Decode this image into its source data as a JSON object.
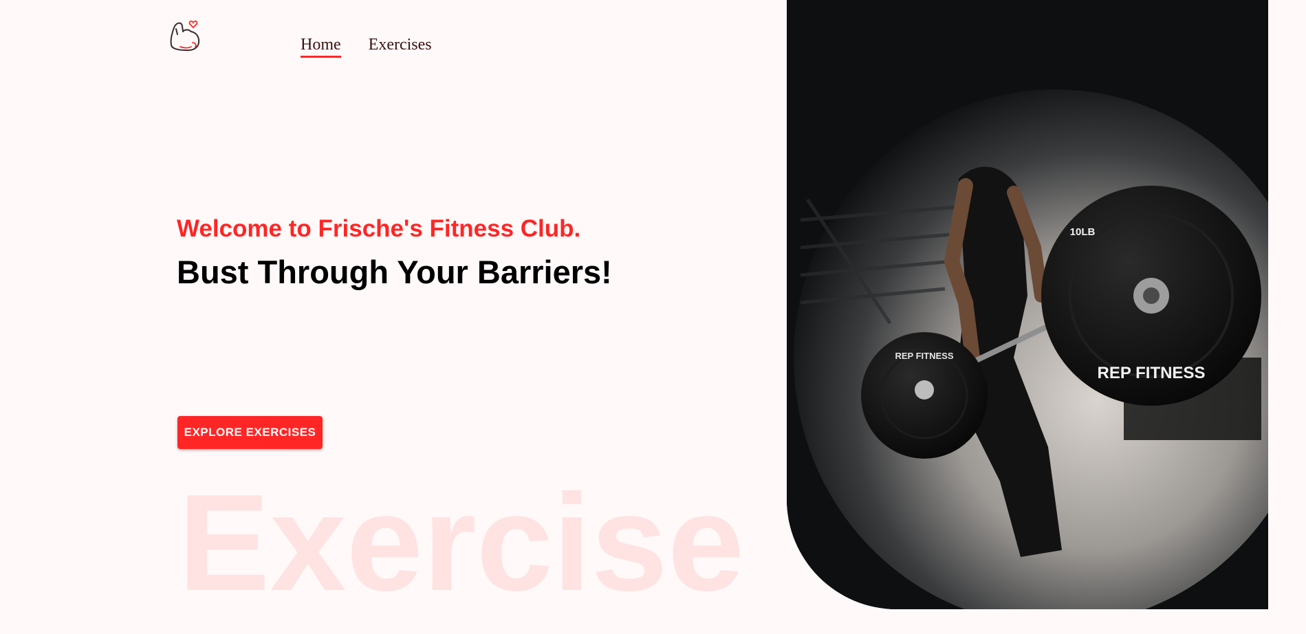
{
  "nav": {
    "logo_icon": "flexed-arm-heart-logo",
    "items": [
      {
        "label": "Home",
        "active": true
      },
      {
        "label": "Exercises",
        "active": false
      }
    ]
  },
  "hero": {
    "subtitle": "Welcome to Frische's Fitness Club.",
    "title": "Bust Through Your Barriers!",
    "cta_label": "EXPLORE EXERCISES",
    "background_word": "Exercise",
    "image_alt": "Person lifting a barbell with REP FITNESS plates",
    "plate_brand": "REP FITNESS",
    "plate_weight": "10LB"
  },
  "colors": {
    "accent": "#ff2625",
    "background": "#fff9f9",
    "nav_text": "#3a1212",
    "hero_bg": "#0d0f10"
  }
}
